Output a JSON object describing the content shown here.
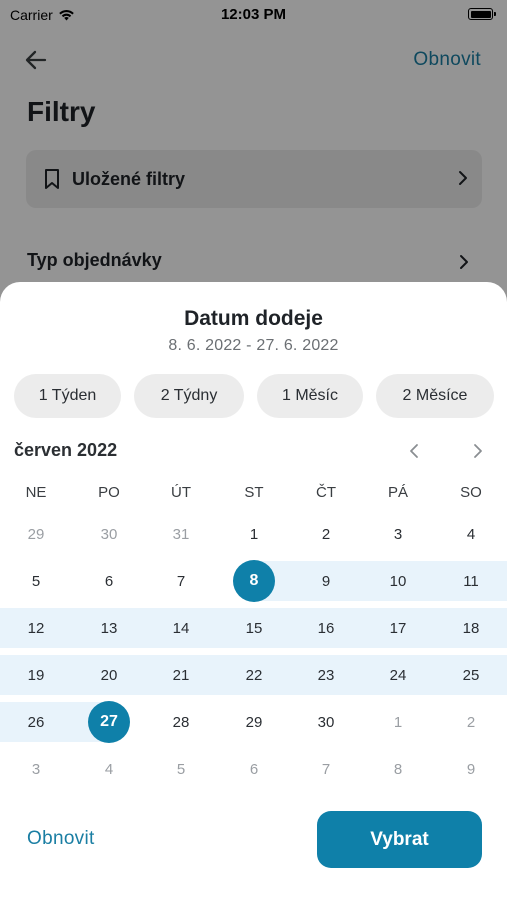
{
  "status_bar": {
    "carrier": "Carrier",
    "time": "12:03 PM"
  },
  "header": {
    "action_label": "Obnovit",
    "title": "Filtry"
  },
  "filters": {
    "saved_filters_label": "Uložené filtry",
    "order_type_label": "Typ objednávky"
  },
  "sheet": {
    "title": "Datum dodeje",
    "subtitle": "8. 6. 2022 - 27. 6. 2022",
    "presets": [
      "1 Týden",
      "2 Týdny",
      "1 Měsíc",
      "2 Měsíce"
    ],
    "month_label": "červen 2022",
    "weekdays": [
      "NE",
      "PO",
      "ÚT",
      "ST",
      "ČT",
      "PÁ",
      "SO"
    ],
    "weeks": [
      [
        {
          "d": "29",
          "muted": true
        },
        {
          "d": "30",
          "muted": true
        },
        {
          "d": "31",
          "muted": true
        },
        {
          "d": "1"
        },
        {
          "d": "2"
        },
        {
          "d": "3"
        },
        {
          "d": "4"
        }
      ],
      [
        {
          "d": "5"
        },
        {
          "d": "6"
        },
        {
          "d": "7"
        },
        {
          "d": "8",
          "selected": true,
          "in_range": true
        },
        {
          "d": "9",
          "in_range": true
        },
        {
          "d": "10",
          "in_range": true
        },
        {
          "d": "11",
          "in_range": true
        }
      ],
      [
        {
          "d": "12",
          "in_range": true
        },
        {
          "d": "13",
          "in_range": true
        },
        {
          "d": "14",
          "in_range": true
        },
        {
          "d": "15",
          "in_range": true
        },
        {
          "d": "16",
          "in_range": true
        },
        {
          "d": "17",
          "in_range": true
        },
        {
          "d": "18",
          "in_range": true
        }
      ],
      [
        {
          "d": "19",
          "in_range": true
        },
        {
          "d": "20",
          "in_range": true
        },
        {
          "d": "21",
          "in_range": true
        },
        {
          "d": "22",
          "in_range": true
        },
        {
          "d": "23",
          "in_range": true
        },
        {
          "d": "24",
          "in_range": true
        },
        {
          "d": "25",
          "in_range": true
        }
      ],
      [
        {
          "d": "26",
          "in_range": true
        },
        {
          "d": "27",
          "selected": true,
          "in_range": true
        },
        {
          "d": "28"
        },
        {
          "d": "29"
        },
        {
          "d": "30"
        },
        {
          "d": "1",
          "muted": true
        },
        {
          "d": "2",
          "muted": true
        }
      ],
      [
        {
          "d": "3",
          "muted": true
        },
        {
          "d": "4",
          "muted": true
        },
        {
          "d": "5",
          "muted": true
        },
        {
          "d": "6",
          "muted": true
        },
        {
          "d": "7",
          "muted": true
        },
        {
          "d": "8",
          "muted": true
        },
        {
          "d": "9",
          "muted": true
        }
      ]
    ],
    "reset_label": "Obnovit",
    "select_label": "Vybrat"
  },
  "colors": {
    "accent": "#0f80a9",
    "range_band": "#e8f3fb",
    "link": "#1a7ea3"
  },
  "icons": {
    "back": "arrow-left-icon",
    "bookmark": "bookmark-icon",
    "chevron": "chevron-right-icon",
    "prev_month": "chevron-left-icon",
    "next_month": "chevron-right-icon",
    "wifi": "wifi-icon",
    "battery": "battery-icon"
  }
}
